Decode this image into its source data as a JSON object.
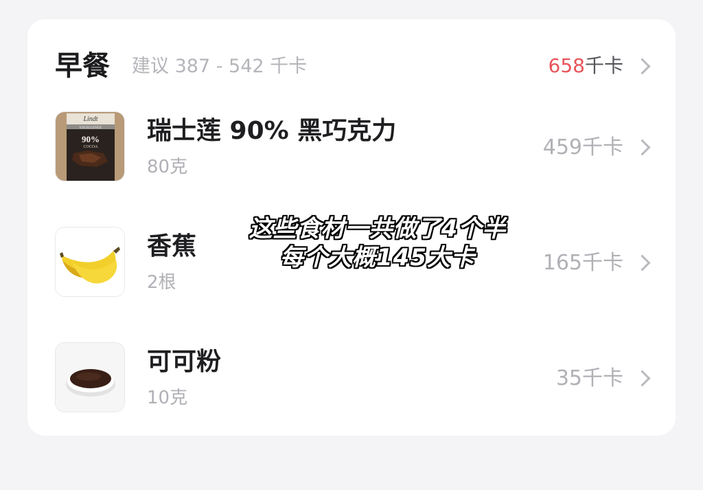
{
  "meal": {
    "title": "早餐",
    "suggestion": "建议 387 - 542 千卡",
    "total_value": "658",
    "total_unit": "千卡"
  },
  "foods": [
    {
      "name": "瑞士莲 90% 黑巧克力",
      "amount": "80克",
      "kcal": "459千卡",
      "image": "dark-chocolate-bar",
      "image_text": {
        "brand": "Lindt",
        "line": "EXCELLENCE",
        "percent": "90%",
        "word": "COCOA"
      }
    },
    {
      "name": "香蕉",
      "amount": "2根",
      "kcal": "165千卡",
      "image": "banana"
    },
    {
      "name": "可可粉",
      "amount": "10克",
      "kcal": "35千卡",
      "image": "cocoa-powder-bowl"
    }
  ],
  "overlay": {
    "line1": "这些食材一共做了4个半",
    "line2": "每个大概145大卡"
  },
  "colors": {
    "background": "#f4f4f6",
    "card": "#ffffff",
    "over_limit": "#e8545a",
    "muted": "#b0b0b6"
  }
}
